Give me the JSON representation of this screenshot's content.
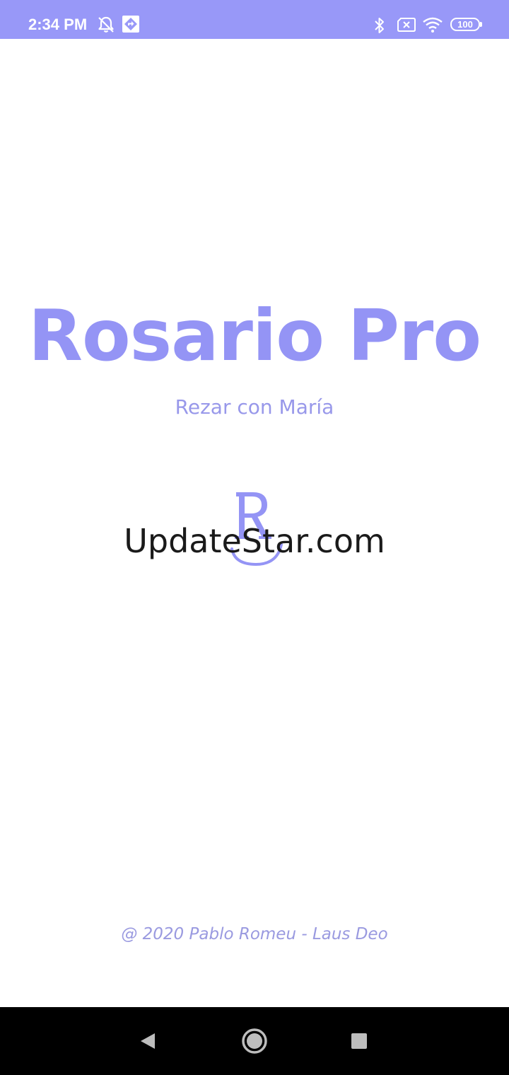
{
  "status_bar": {
    "time": "2:34 PM",
    "battery": "100",
    "icons": [
      "alarm-off-icon",
      "navigation-app-icon",
      "bluetooth-icon",
      "no-sim-icon",
      "wifi-icon",
      "battery-icon"
    ],
    "background": "#9898f8"
  },
  "splash": {
    "title": "Rosario Pro",
    "subtitle": "Rezar con María",
    "logo_icon": "rosary-r-logo-icon",
    "watermark": "UpdateStar.com",
    "credit": "@ 2020 Pablo Romeu - Laus Deo",
    "accent_color": "#9494f5"
  },
  "nav_bar": {
    "buttons": [
      "back-icon",
      "home-icon",
      "recents-icon"
    ]
  }
}
